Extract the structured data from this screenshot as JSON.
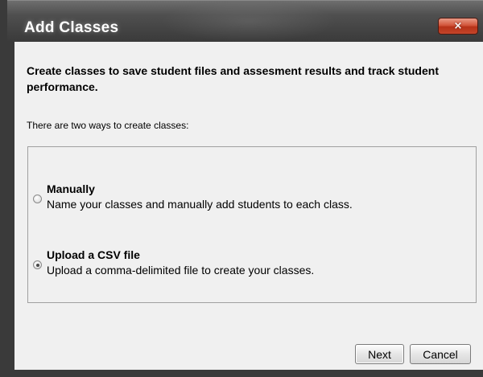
{
  "window": {
    "title": "Add Classes",
    "close_label": "×"
  },
  "content": {
    "heading": "Create classes to save student files and assesment results and track student performance.",
    "subtext": "There are two ways to create classes:"
  },
  "options": [
    {
      "title": "Manually",
      "description": "Name your classes and manually add students to each class.",
      "selected": false
    },
    {
      "title": "Upload a CSV file",
      "description": "Upload a comma-delimited file to create your classes.",
      "selected": true
    }
  ],
  "buttons": {
    "next_label": "Next",
    "cancel_label": "Cancel"
  },
  "colors": {
    "titlebar": "#3a3a3a",
    "close_button": "#c4452a",
    "dialog_background": "#f0f0f0"
  }
}
